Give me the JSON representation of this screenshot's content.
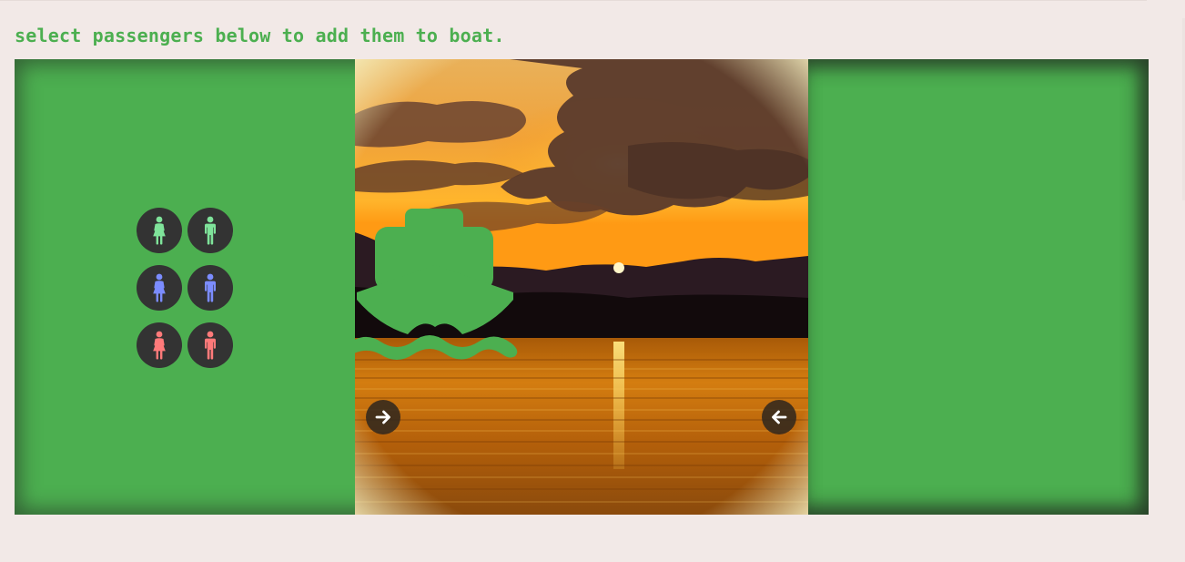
{
  "instruction": "select passengers below to add them to boat.",
  "colors": {
    "page_background": "#f2e9e7",
    "bank_green": "#4caf50",
    "passenger_circle": "#333333",
    "boat": "#4caf50"
  },
  "left_bank": {
    "passengers": [
      {
        "name": "passenger-green-female",
        "icon": "female-icon",
        "color": "#7fe39a"
      },
      {
        "name": "passenger-green-male",
        "icon": "male-icon",
        "color": "#7fe39a"
      },
      {
        "name": "passenger-blue-female",
        "icon": "female-icon",
        "color": "#7b8cff"
      },
      {
        "name": "passenger-blue-male",
        "icon": "male-icon",
        "color": "#7b8cff"
      },
      {
        "name": "passenger-red-female",
        "icon": "female-icon",
        "color": "#ff7a7a"
      },
      {
        "name": "passenger-red-male",
        "icon": "male-icon",
        "color": "#ff7a7a"
      }
    ]
  },
  "river": {
    "background": "sunset-lake-scene",
    "boat_icon": "ferry-icon",
    "buttons": [
      {
        "name": "move-right-button",
        "icon": "arrow-right-icon"
      },
      {
        "name": "move-left-button",
        "icon": "arrow-left-icon"
      }
    ]
  },
  "right_bank": {
    "passengers": []
  }
}
